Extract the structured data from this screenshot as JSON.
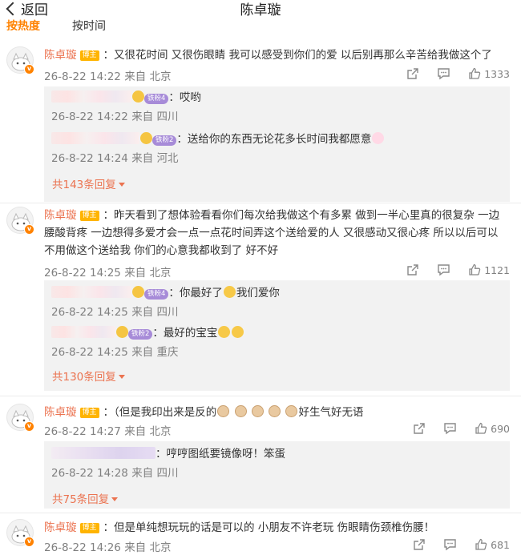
{
  "header": {
    "back_label": "返回",
    "title": "陈卓璇",
    "tab_hot": "按热度",
    "tab_time": "按时间"
  },
  "comments": [
    {
      "author": "陈卓璇",
      "tag": "博主",
      "text": "：又很花时间 又很伤眼睛 我可以感受到你们的爱 以后别再那么辛苦给我做这个了",
      "time": "26-8-22 14:22",
      "location": "来自 北京",
      "likes": "1333",
      "replies": [
        {
          "fan_badge": "铁粉4",
          "text": "：哎哟",
          "time": "26-8-22 14:22",
          "location": "来自 四川"
        },
        {
          "fan_badge": "铁粉2",
          "text": "：送给你的东西无论花多长时间我都愿意",
          "time": "26-8-22 14:24",
          "location": "来自 河北"
        }
      ],
      "more": "共143条回复"
    },
    {
      "author": "陈卓璇",
      "tag": "博主",
      "text_lines": [
        "：昨天看到了想体验看看你们每次给我做这个有多累 做到一半心里真的很复杂 一边",
        "腰酸背疼 一边想得多爱才会一点一点花时间弄这个送给爱的人 又很感动又很心疼 所以以后可以",
        "不用做这个送给我 你们的心意我都收到了 好不好"
      ],
      "time": "26-8-22 14:25",
      "location": "来自 北京",
      "likes": "1121",
      "replies": [
        {
          "fan_badge": "铁粉4",
          "text": "：你最好了",
          "text_after": "我们爱你",
          "time": "26-8-22 14:25",
          "location": "来自 四川"
        },
        {
          "fan_badge": "铁粉2",
          "text": "：最好的宝宝",
          "time": "26-8-22 14:25",
          "location": "来自 重庆"
        }
      ],
      "more": "共130条回复"
    },
    {
      "author": "陈卓璇",
      "tag": "博主",
      "text": "：（但是我印出来是反的",
      "text_after": "好生气好无语",
      "time": "26-8-22 14:27",
      "location": "来自 北京",
      "likes": "690",
      "replies": [
        {
          "text": "：哼哼图纸要镜像呀！笨蛋",
          "time": "26-8-22 14:28",
          "location": "来自 四川"
        }
      ],
      "more": "共75条回复"
    },
    {
      "author": "陈卓璇",
      "tag": "博主",
      "text": "：但是单纯想玩玩的话是可以的 小朋友不许老玩 伤眼睛伤颈椎伤腰！",
      "time": "26-8-22 14:26",
      "location": "来自 北京",
      "likes": "681"
    }
  ],
  "colors": {
    "accent": "#eb7350",
    "hot_tab": "#ff8200",
    "meta": "#808080",
    "reply_bg": "#f2f2f2"
  }
}
